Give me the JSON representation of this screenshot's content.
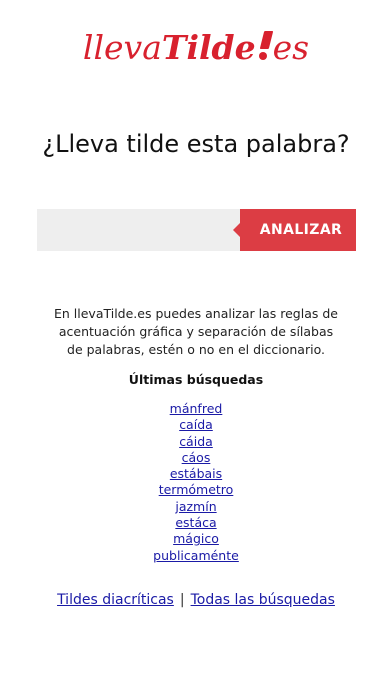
{
  "logo": {
    "part1": "lleva",
    "part2": "Tilde",
    "part3": "es",
    "color": "#d8212e",
    "icon": "exclamation-dot-icon"
  },
  "heading": "¿Lleva tilde esta palabra?",
  "search": {
    "value": "",
    "placeholder": "",
    "button_label": "ANALIZAR",
    "button_color": "#dc3d44"
  },
  "description": "En llevaTilde.es puedes analizar las reglas de acentuación gráfica y separación de sílabas de palabras, estén o no en el diccionario.",
  "recent": {
    "title": "Últimas búsquedas",
    "items": [
      "mánfred",
      "caída",
      "cáida",
      "cáos",
      "estábais",
      "termómetro",
      "jazmín",
      "estáca",
      "mágico",
      "publicaménte"
    ]
  },
  "footer": {
    "link1": "Tildes diacríticas",
    "separator": "|",
    "link2": "Todas las búsquedas"
  },
  "colors": {
    "link": "#1a1aa6",
    "input_bg": "#eeeeee"
  }
}
